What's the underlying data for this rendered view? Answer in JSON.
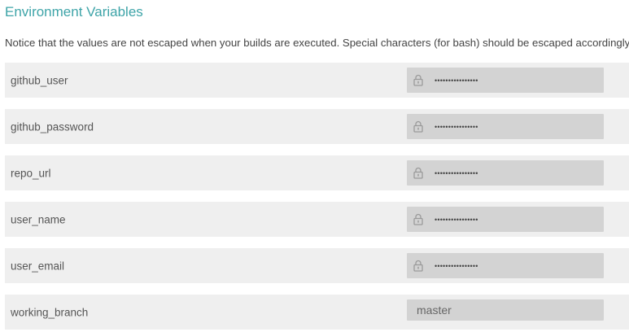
{
  "section": {
    "title": "Environment Variables",
    "notice": "Notice that the values are not escaped when your builds are executed. Special characters (for bash) should be escaped accordingly."
  },
  "env_vars": [
    {
      "name": "github_user",
      "value": "••••••••••••••••",
      "secret": true,
      "icon": "lock-icon"
    },
    {
      "name": "github_password",
      "value": "••••••••••••••••",
      "secret": true,
      "icon": "lock-icon"
    },
    {
      "name": "repo_url",
      "value": "••••••••••••••••",
      "secret": true,
      "icon": "lock-icon"
    },
    {
      "name": "user_name",
      "value": "••••••••••••••••",
      "secret": true,
      "icon": "lock-icon"
    },
    {
      "name": "user_email",
      "value": "••••••••••••••••",
      "secret": true,
      "icon": "lock-icon"
    },
    {
      "name": "working_branch",
      "value": "master",
      "secret": false
    }
  ],
  "colors": {
    "title": "#3ea4a8",
    "row_background": "#efefef",
    "value_background": "#d3d3d3"
  }
}
